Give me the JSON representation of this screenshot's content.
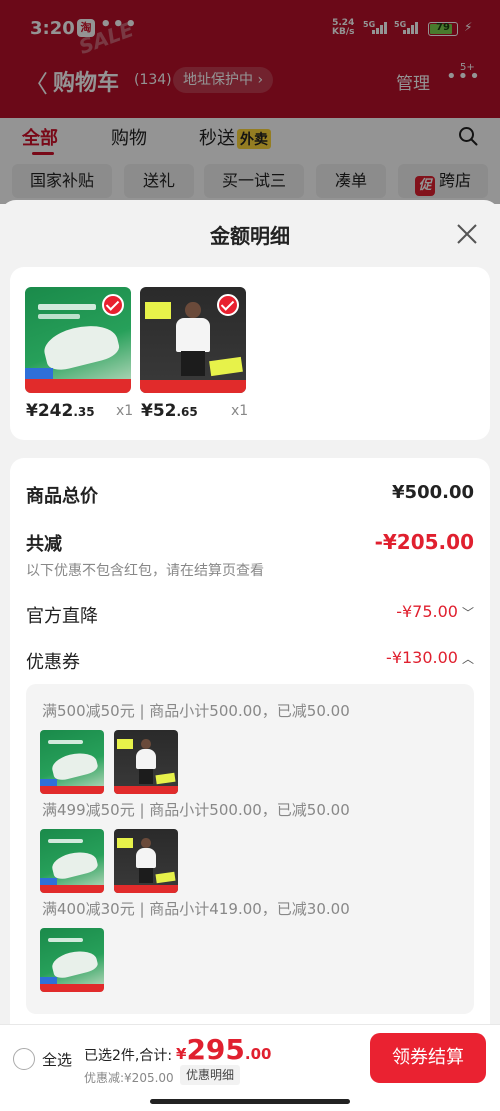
{
  "status": {
    "time": "3:20",
    "app_badge": "淘",
    "dots": "•••",
    "net_speed": "5.24",
    "net_unit": "KB/s",
    "sig1": "5G",
    "sig2": "5G",
    "battery": "79",
    "battery_level": 0.79,
    "bolt": "⚡",
    "watermark": "SALE"
  },
  "header": {
    "back": "〈",
    "title": "购物车",
    "count": "(134)",
    "address": "地址保护中",
    "address_arrow": "›",
    "manage": "管理",
    "more": "•••",
    "more_badge": "5+"
  },
  "tabs": {
    "all": "全部",
    "shopping": "购物",
    "fast": "秒送",
    "takeout": "外卖"
  },
  "chips": [
    "国家补贴",
    "送礼",
    "买一试三",
    "凑单",
    "跨店"
  ],
  "chip_badge": "促",
  "sheet": {
    "title": "金额明细",
    "products": [
      {
        "price_int": "¥242",
        "price_dec": ".35",
        "qty": "x1"
      },
      {
        "price_int": "¥52",
        "price_dec": ".65",
        "qty": "x1"
      }
    ],
    "total_label": "商品总价",
    "total_value": "¥500.00",
    "reduce_label": "共减",
    "reduce_value": "-¥205.00",
    "reduce_note": "以下优惠不包含红包，请在结算页查看",
    "official_label": "官方直降",
    "official_value": "-¥75.00",
    "coupon_label": "优惠券",
    "coupon_value": "-¥130.00",
    "coupons": [
      "满500减50元 | 商品小计500.00，已减50.00",
      "满499减50元 | 商品小计500.00，已减50.00",
      "满400减30元 | 商品小计419.00，已减30.00"
    ]
  },
  "bottom": {
    "select_all": "全选",
    "summary": "已选2件,合计:",
    "currency": "¥",
    "total_big": "295",
    "total_dec": ".00",
    "discount": "优惠减:¥205.00",
    "detail": "优惠明细",
    "checkout": "领券结算"
  },
  "colors": {
    "brand_red": "#e0202f",
    "header_red": "#b8102a"
  }
}
